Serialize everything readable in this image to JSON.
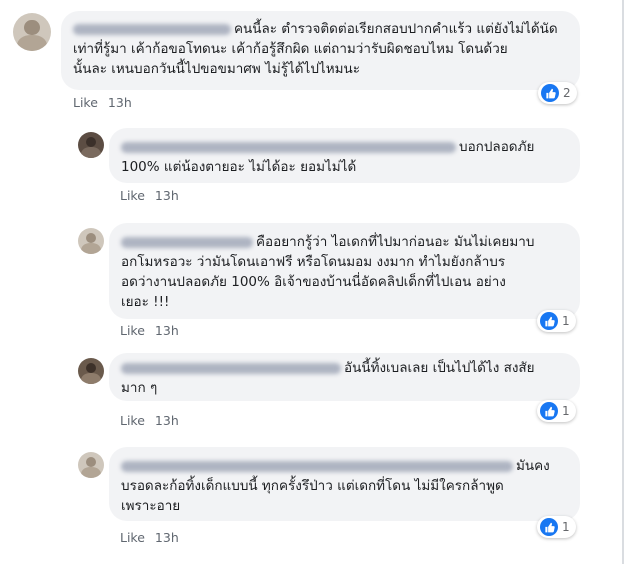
{
  "comments": [
    {
      "level": 0,
      "reply_to": "",
      "text_lines": [
        "คนนี้ละ ตำรวจติดต่อเรียกสอบปากคำแร้ว แต่ยังไม่ได้นัด",
        "เท่าที่รู้มา เค้าก้อขอโทดนะ เค้าก้อรู้สึกผิด แต่ถามว่ารับผิดชอบไหม โดนด้วย",
        "นั้นละ เหนบอกวันนี้ไปขอขมาศพ ไม่รู้ได้ไปไหมนะ"
      ],
      "like_label": "Like",
      "time": "13h",
      "reactions": "2"
    },
    {
      "level": 1,
      "reply_to": "",
      "text_lines": [
        "บอกปลอดภัย",
        "100% แต่น้องตายอะ ไม่ได้อะ ยอมไม่ได้"
      ],
      "like_label": "Like",
      "time": "13h",
      "reactions": ""
    },
    {
      "level": 1,
      "reply_to": "",
      "text_lines": [
        "คืออยากรู้ว่า ไอเดกที่ไปมาก่อนอะ มันไม่เคยมาบ",
        "อกโมหรอวะ ว่ามันโดนเอาฟรี หรือโดนมอม งงมาก ทำไมยังกล้าบร",
        "อดว่างานปลอดภัย 100% อิเจ้าของบ้านนี่อัดคลิปเด็กที่ไปเอน อย่าง",
        "เยอะ !!!"
      ],
      "like_label": "Like",
      "time": "13h",
      "reactions": "1"
    },
    {
      "level": 1,
      "reply_to": "",
      "text_lines": [
        "อันนี้ทิ้งเบลเลย เป็นไปได้ไง สงสัย",
        "มาก ๆ"
      ],
      "like_label": "Like",
      "time": "13h",
      "reactions": "1"
    },
    {
      "level": 1,
      "reply_to": "",
      "text_lines": [
        "มันคง",
        "บรอดละก้อทิ้งเด็กแบบนี้ ทุกครั้งรึป่าว แต่เดกที่โดน ไม่มีใครกล้าพูด",
        "เพราะอาย"
      ],
      "like_label": "Like",
      "time": "13h",
      "reactions": "1"
    }
  ],
  "colors": {
    "bubble": "#f2f3f5",
    "like_blue": "#1877f2",
    "meta": "#606770"
  },
  "icons": {
    "reaction": "thumbs-up-icon"
  }
}
